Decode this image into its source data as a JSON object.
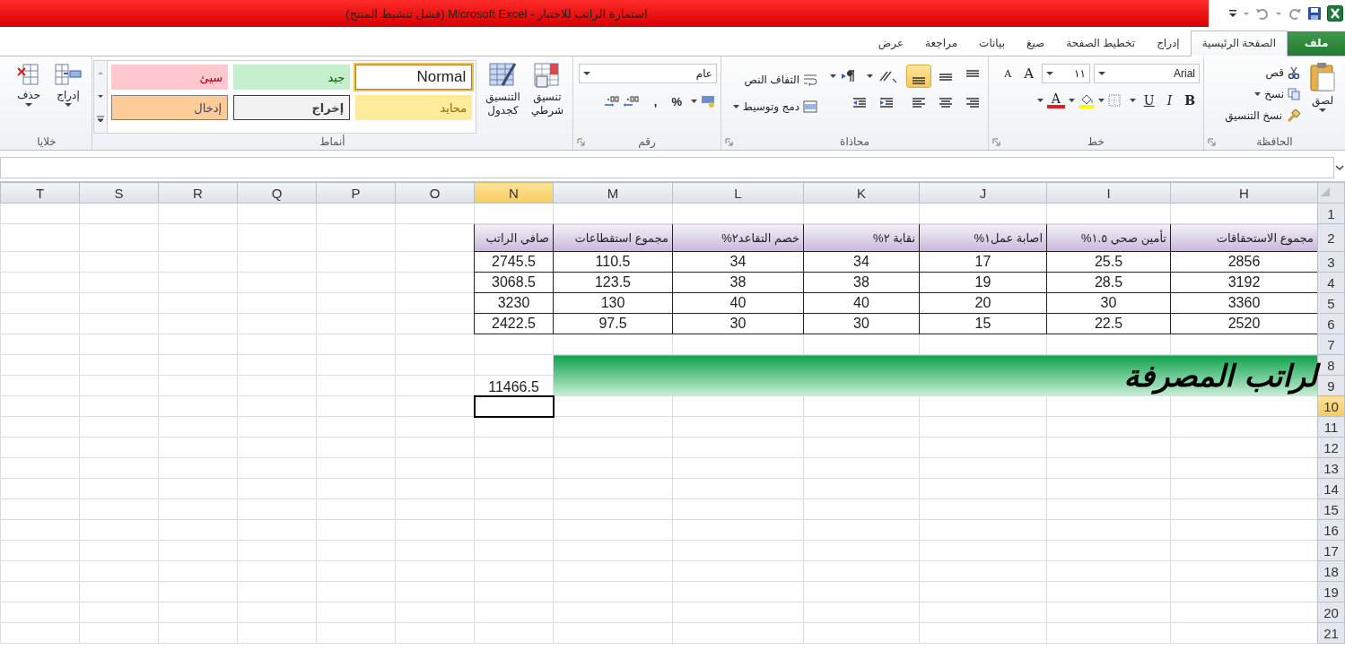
{
  "window": {
    "title": "استمارة الراتب للاختبار - Microsoft Excel (فشل تنشيط المنتج)"
  },
  "tabs": [
    {
      "label": "ملف",
      "kind": "file",
      "selected": false
    },
    {
      "label": "الصفحة الرئيسية",
      "kind": "tab",
      "selected": true
    },
    {
      "label": "إدراج",
      "kind": "tab",
      "selected": false
    },
    {
      "label": "تخطيط الصفحة",
      "kind": "tab",
      "selected": false
    },
    {
      "label": "صيغ",
      "kind": "tab",
      "selected": false
    },
    {
      "label": "بيانات",
      "kind": "tab",
      "selected": false
    },
    {
      "label": "مراجعة",
      "kind": "tab",
      "selected": false
    },
    {
      "label": "عرض",
      "kind": "tab",
      "selected": false
    }
  ],
  "ribbon": {
    "clipboard": {
      "label": "الحافظة",
      "paste": "لصق",
      "cut": "قص",
      "copy": "نسخ",
      "format_painter": "نسخ التنسيق"
    },
    "font": {
      "label": "خط",
      "name": "Arial",
      "size": "١١",
      "grow": "A",
      "shrink": "A",
      "bold": "B",
      "italic": "I",
      "underline": "U",
      "font_color": "A"
    },
    "alignment": {
      "label": "محاذاة",
      "wrap_text": "التفاف النص",
      "merge": "دمج وتوسيط",
      "vertical": [
        {
          "kind": "top",
          "selected": false
        },
        {
          "kind": "middle",
          "selected": false
        },
        {
          "kind": "bottom",
          "selected": true
        }
      ]
    },
    "number": {
      "label": "رقم",
      "format": "عام",
      "percent": "%",
      "comma": ","
    },
    "styles": {
      "label": "أنماط",
      "conditional": "تنسيق شرطي",
      "as_table": "التنسيق كجدول",
      "cell_styles": [
        {
          "label": "Normal",
          "kind": "normal",
          "selected": true
        },
        {
          "label": "جيد",
          "kind": "good",
          "selected": false
        },
        {
          "label": "سيئ",
          "kind": "bad",
          "selected": false
        },
        {
          "label": "محايد",
          "kind": "neutral",
          "selected": false
        },
        {
          "label": "إخراج",
          "kind": "output",
          "selected": false
        },
        {
          "label": "إدخال",
          "kind": "input",
          "selected": false
        }
      ]
    },
    "cells": {
      "label": "خلايا",
      "insert": "إدراج",
      "delete": "حذف"
    }
  },
  "sheet": {
    "columns": [
      {
        "label": "H",
        "selected": false
      },
      {
        "label": "I",
        "selected": false
      },
      {
        "label": "J",
        "selected": false
      },
      {
        "label": "K",
        "selected": false
      },
      {
        "label": "L",
        "selected": false
      },
      {
        "label": "M",
        "selected": false
      },
      {
        "label": "N",
        "selected": true
      },
      {
        "label": "O",
        "selected": false
      },
      {
        "label": "P",
        "selected": false
      },
      {
        "label": "Q",
        "selected": false
      },
      {
        "label": "R",
        "selected": false
      },
      {
        "label": "S",
        "selected": false
      },
      {
        "label": "T",
        "selected": false
      }
    ],
    "rows": [
      {
        "label": "1",
        "selected": false
      },
      {
        "label": "2",
        "selected": false
      },
      {
        "label": "3",
        "selected": false
      },
      {
        "label": "4",
        "selected": false
      },
      {
        "label": "5",
        "selected": false
      },
      {
        "label": "6",
        "selected": false
      },
      {
        "label": "7",
        "selected": false
      },
      {
        "label": "8",
        "selected": false
      },
      {
        "label": "9",
        "selected": false
      },
      {
        "label": "10",
        "selected": true
      },
      {
        "label": "11",
        "selected": false
      },
      {
        "label": "12",
        "selected": false
      },
      {
        "label": "13",
        "selected": false
      },
      {
        "label": "14",
        "selected": false
      },
      {
        "label": "15",
        "selected": false
      },
      {
        "label": "16",
        "selected": false
      },
      {
        "label": "17",
        "selected": false
      },
      {
        "label": "18",
        "selected": false
      },
      {
        "label": "19",
        "selected": false
      },
      {
        "label": "20",
        "selected": false
      },
      {
        "label": "21",
        "selected": false
      }
    ],
    "table": {
      "header": [
        "مجموع الاستحقاقات",
        "تأمين صحي ١.٥%",
        "اصابة عمل١%",
        "نقابة ٢%",
        "خصم التقاعد٢%",
        "مجموع استقطاعات",
        "صافي الراتب"
      ],
      "rows": [
        [
          "2856",
          "25.5",
          "17",
          "34",
          "34",
          "110.5",
          "2745.5"
        ],
        [
          "3192",
          "28.5",
          "19",
          "38",
          "38",
          "123.5",
          "3068.5"
        ],
        [
          "3360",
          "30",
          "20",
          "40",
          "40",
          "130",
          "3230"
        ],
        [
          "2520",
          "22.5",
          "15",
          "30",
          "30",
          "97.5",
          "2422.5"
        ]
      ]
    },
    "banner": "لراتب المصرفة",
    "total": "11466.5"
  }
}
